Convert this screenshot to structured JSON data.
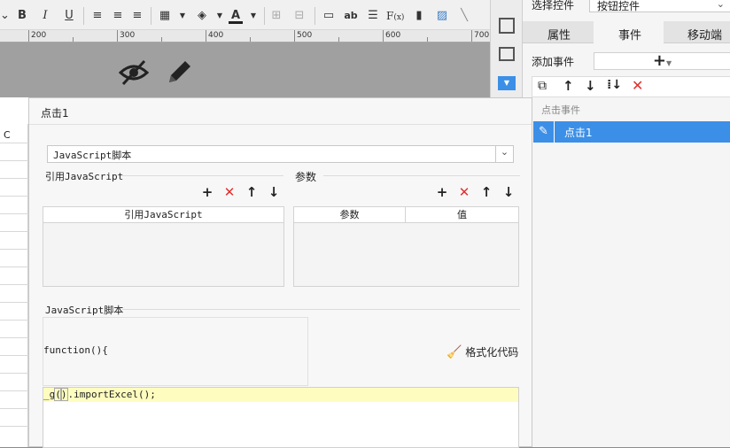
{
  "ruler": {
    "marks": [
      "200",
      "300",
      "400",
      "500",
      "600",
      "700"
    ]
  },
  "toolbar": {
    "abc": "ab"
  },
  "right_panel": {
    "select_label": "选择控件",
    "select_value": "按钮控件",
    "tabs": [
      "属性",
      "事件",
      "移动端"
    ],
    "add_event_label": "添加事件",
    "event_group": "点击事件",
    "event_item": "点击1"
  },
  "dialog": {
    "title": "点击1",
    "script_type": "JavaScript脚本",
    "ref_js_legend": "引用JavaScript",
    "params_legend": "参数",
    "ref_js_header": "引用JavaScript",
    "params_header": "参数",
    "value_header": "值",
    "script_section": "JavaScript脚本",
    "function_decl": "function(){",
    "format_code": "格式化代码",
    "code_line": {
      "prefix": "_g",
      "paren_open": "(",
      "paren_close": ")",
      "method": ".importExcel",
      "call": "();"
    }
  },
  "sheet": {
    "column": "C"
  },
  "colors": {
    "accent": "#3c8fe6",
    "delete": "#e03030",
    "code_highlight": "#fefdbf"
  }
}
